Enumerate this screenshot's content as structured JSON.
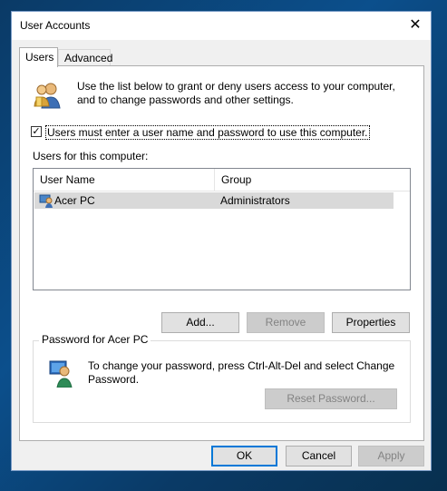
{
  "window": {
    "title": "User Accounts",
    "close_glyph": "✕"
  },
  "tabs": [
    {
      "label": "Users"
    },
    {
      "label": "Advanced"
    }
  ],
  "intro": {
    "text": "Use the list below to grant or deny users access to your computer, and to change passwords and other settings."
  },
  "require_login": {
    "label": "Users must enter a user name and password to use this computer.",
    "checked": true,
    "check_glyph": "✓"
  },
  "users_list": {
    "label": "Users for this computer:",
    "columns": [
      "User Name",
      "Group"
    ],
    "rows": [
      {
        "user": "Acer PC",
        "group": "Administrators"
      }
    ]
  },
  "buttons": {
    "add": "Add...",
    "remove": "Remove",
    "properties": "Properties"
  },
  "password_group": {
    "label": "Password for Acer PC",
    "text": "To change your password, press Ctrl-Alt-Del and select Change Password.",
    "reset": "Reset Password..."
  },
  "footer": {
    "ok": "OK",
    "cancel": "Cancel",
    "apply": "Apply"
  }
}
